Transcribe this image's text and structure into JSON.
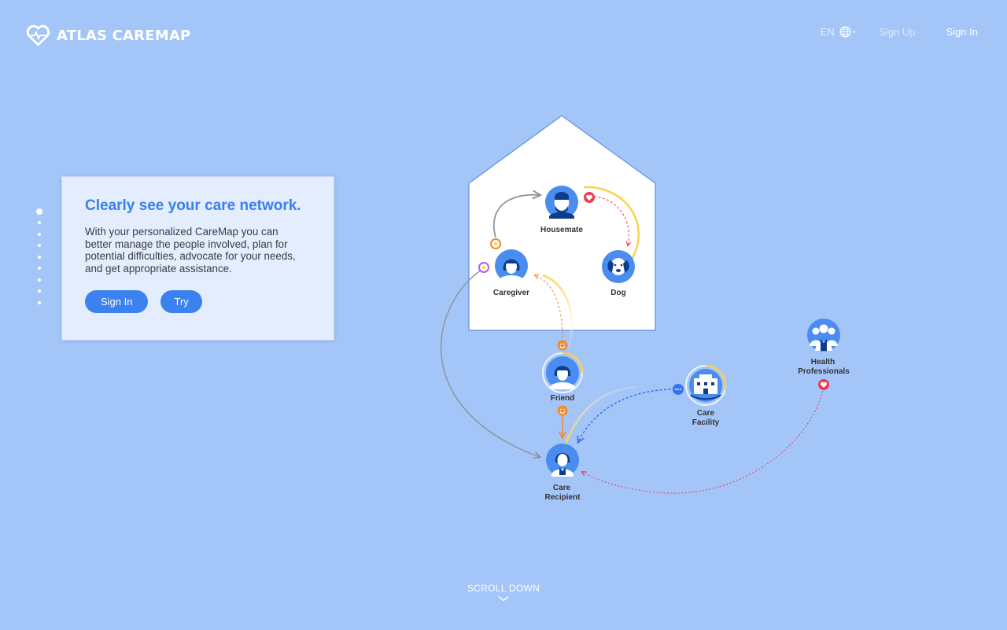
{
  "brand": {
    "name": "ATLAS CAREMAP"
  },
  "nav": {
    "language": "EN",
    "sign_up": "Sign Up",
    "sign_in": "Sign In"
  },
  "pager": {
    "count": 9,
    "active_index": 0
  },
  "hero": {
    "title": "Clearly see your care network.",
    "body": "With your personalized CareMap you can\nbetter  manage the people involved, plan for\npotential difficulties, advocate for your needs,\nand get appropriate assistance.",
    "sign_in_button": "Sign In",
    "try_button": "Try"
  },
  "nodes": {
    "housemate": "Housemate",
    "caregiver": "Caregiver",
    "dog": "Dog",
    "friend": "Friend",
    "care_facility_line1": "Care",
    "care_facility_line2": "Facility",
    "care_recipient_line1": "Care",
    "care_recipient_line2": "Recipient",
    "health_line1": "Health",
    "health_line2": "Professionals"
  },
  "scroll": {
    "label": "SCROLL DOWN"
  },
  "colors": {
    "background": "#a4c5f8",
    "accent": "#3b82f0",
    "title": "#3a7ff0",
    "node_fill": "#4a8cf0",
    "node_dark": "#0d3c8c",
    "heart": "#ef3b4e",
    "smile": "#f28a2e",
    "gold_arc": "#f8d24a"
  },
  "icons": [
    "heart-logo-icon",
    "globe-icon",
    "chevron-down-icon",
    "heart-badge-icon",
    "smile-badge-icon",
    "more-badge-icon"
  ]
}
